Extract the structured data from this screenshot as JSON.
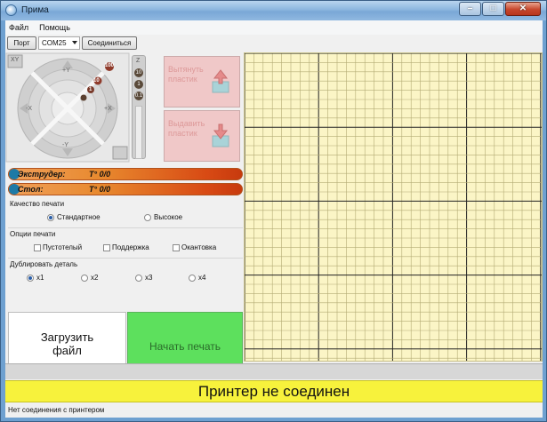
{
  "window": {
    "title": "Прима"
  },
  "menu": {
    "file": "Файл",
    "help": "Помощь"
  },
  "toolbar": {
    "port_label": "Порт",
    "port_value": "COM25",
    "connect_label": "Соединиться"
  },
  "jog": {
    "labels": [
      "-X",
      "+X",
      "-Y",
      "+Y",
      "10",
      "100",
      "10",
      "1",
      "0.1",
      "1"
    ],
    "z_steps": [
      "10",
      "1",
      "0.1"
    ],
    "home_xy": "XY",
    "home_z": "Z"
  },
  "side_buttons": {
    "retract": "Вытянуть пластик",
    "extrude": "Выдавить пластик"
  },
  "temps": [
    {
      "name": "Экструдер:",
      "value": "T° 0/0"
    },
    {
      "name": "Стол:",
      "value": "T° 0/0"
    }
  ],
  "quality": {
    "label": "Качество печати",
    "options": [
      "Стандартное",
      "Высокое"
    ],
    "selected": 0
  },
  "print_options": {
    "label": "Опции печати",
    "options": [
      "Пустотелый",
      "Поддержка",
      "Окантовка"
    ]
  },
  "duplicate": {
    "label": "Дублировать деталь",
    "options": [
      "x1",
      "x2",
      "x3",
      "x4"
    ],
    "selected": 0
  },
  "actions": {
    "load": "Загрузить файл",
    "print": "Начать печать"
  },
  "banner": "Принтер не соединен",
  "status": "Нет соединения с принтером"
}
